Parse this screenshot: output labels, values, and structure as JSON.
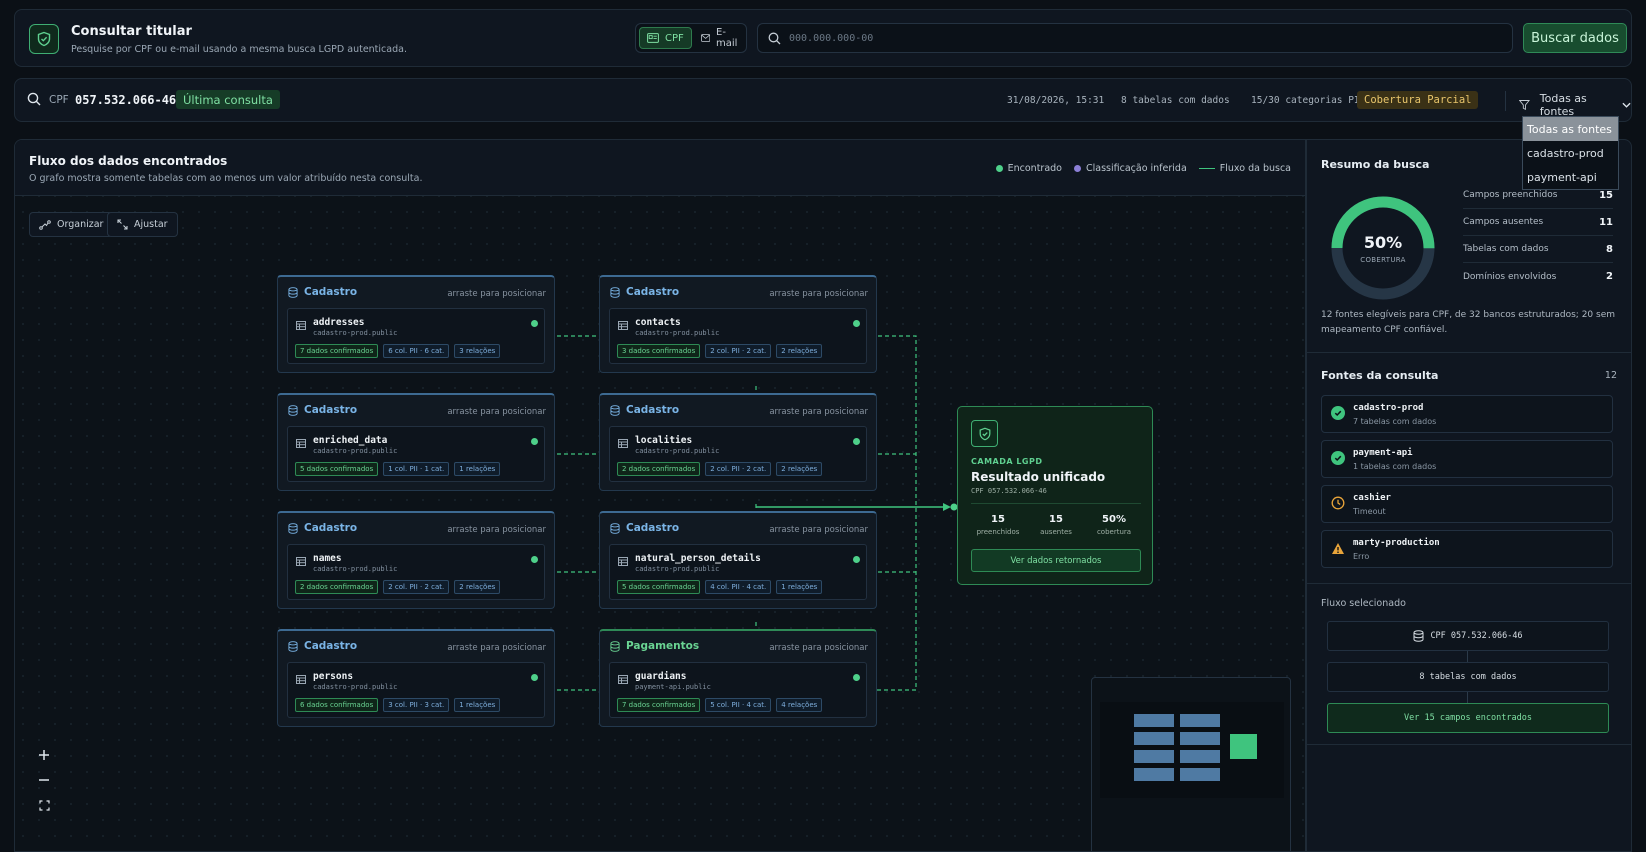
{
  "header": {
    "title": "Consultar titular",
    "subtitle": "Pesquise por CPF ou e-mail usando a mesma busca LGPD autenticada.",
    "modes": [
      {
        "label": "CPF",
        "active": true
      },
      {
        "label": "E-mail",
        "active": false
      }
    ],
    "search_placeholder": "000.000.000-00",
    "search_button": "Buscar dados"
  },
  "query": {
    "type_label": "CPF",
    "value": "057.532.066-46",
    "badge": "Última consulta",
    "timestamp": "31/08/2026, 15:31",
    "tables": "8 tabelas com dados",
    "categories": "15/30 categorias PII",
    "coverage_badge": "Cobertura Parcial",
    "filter_label": "Todas as fontes",
    "filter_options": [
      "Todas as fontes",
      "cadastro-prod",
      "payment-api"
    ]
  },
  "flow": {
    "title": "Fluxo dos dados encontrados",
    "subtitle": "O grafo mostra somente tabelas com ao menos um valor atribuído nesta consulta.",
    "legend": [
      "Encontrado",
      "Classificação inferida",
      "Fluxo da busca"
    ],
    "toolbar": {
      "organize": "Organizar",
      "fit": "Ajustar"
    },
    "drag_hint": "arraste para posicionar",
    "nodes": [
      {
        "group": "Cadastro",
        "name": "addresses",
        "schema": "cadastro-prod.public",
        "tags": [
          "7 dados confirmados",
          "6 col. PII · 6 cat.",
          "3 relações"
        ]
      },
      {
        "group": "Cadastro",
        "name": "contacts",
        "schema": "cadastro-prod.public",
        "tags": [
          "3 dados confirmados",
          "2 col. PII · 2 cat.",
          "2 relações"
        ]
      },
      {
        "group": "Cadastro",
        "name": "enriched_data",
        "schema": "cadastro-prod.public",
        "tags": [
          "5 dados confirmados",
          "1 col. PII · 1 cat.",
          "1 relações"
        ]
      },
      {
        "group": "Cadastro",
        "name": "localities",
        "schema": "cadastro-prod.public",
        "tags": [
          "2 dados confirmados",
          "2 col. PII · 2 cat.",
          "2 relações"
        ]
      },
      {
        "group": "Cadastro",
        "name": "names",
        "schema": "cadastro-prod.public",
        "tags": [
          "2 dados confirmados",
          "2 col. PII · 2 cat.",
          "2 relações"
        ]
      },
      {
        "group": "Cadastro",
        "name": "natural_person_details",
        "schema": "cadastro-prod.public",
        "tags": [
          "5 dados confirmados",
          "4 col. PII · 4 cat.",
          "1 relações"
        ]
      },
      {
        "group": "Cadastro",
        "name": "persons",
        "schema": "cadastro-prod.public",
        "tags": [
          "6 dados confirmados",
          "3 col. PII · 3 cat.",
          "1 relações"
        ]
      },
      {
        "group": "Pagamentos",
        "name": "guardians",
        "schema": "payment-api.public",
        "tags": [
          "7 dados confirmados",
          "5 col. PII · 4 cat.",
          "4 relações"
        ]
      }
    ],
    "result": {
      "eyebrow": "CAMADA LGPD",
      "title": "Resultado unificado",
      "cpf": "CPF 057.532.066-46",
      "stats": [
        {
          "value": "15",
          "label": "preenchidos"
        },
        {
          "value": "15",
          "label": "ausentes"
        },
        {
          "value": "50%",
          "label": "cobertura"
        }
      ],
      "button": "Ver dados retornados"
    }
  },
  "summary": {
    "title": "Resumo da busca",
    "coverage_pct": "50%",
    "coverage_fraction": 0.5,
    "coverage_label": "COBERTURA",
    "rows": [
      {
        "label": "Campos preenchidos",
        "value": "15"
      },
      {
        "label": "Campos ausentes",
        "value": "11"
      },
      {
        "label": "Tabelas com dados",
        "value": "8"
      },
      {
        "label": "Domínios envolvidos",
        "value": "2"
      }
    ],
    "note": "12 fontes elegíveis para CPF, de 32 bancos estruturados; 20 sem mapeamento CPF confiável."
  },
  "sources": {
    "title": "Fontes da consulta",
    "count": "12",
    "items": [
      {
        "name": "cadastro-prod",
        "status": "7 tabelas com dados",
        "state": "ok"
      },
      {
        "name": "payment-api",
        "status": "1 tabelas com dados",
        "state": "ok"
      },
      {
        "name": "cashier",
        "status": "Timeout",
        "state": "timeout"
      },
      {
        "name": "marty-production",
        "status": "Erro",
        "state": "error"
      }
    ]
  },
  "selected_flow": {
    "title": "Fluxo selecionado",
    "steps": [
      "CPF 057.532.066-46",
      "8 tabelas com dados",
      "Ver 15 campos encontrados"
    ]
  },
  "colors": {
    "found": "#4ed08a",
    "inferred": "#8b7fd6",
    "accent": "#2e8a55",
    "warning": "#e8a43a"
  }
}
